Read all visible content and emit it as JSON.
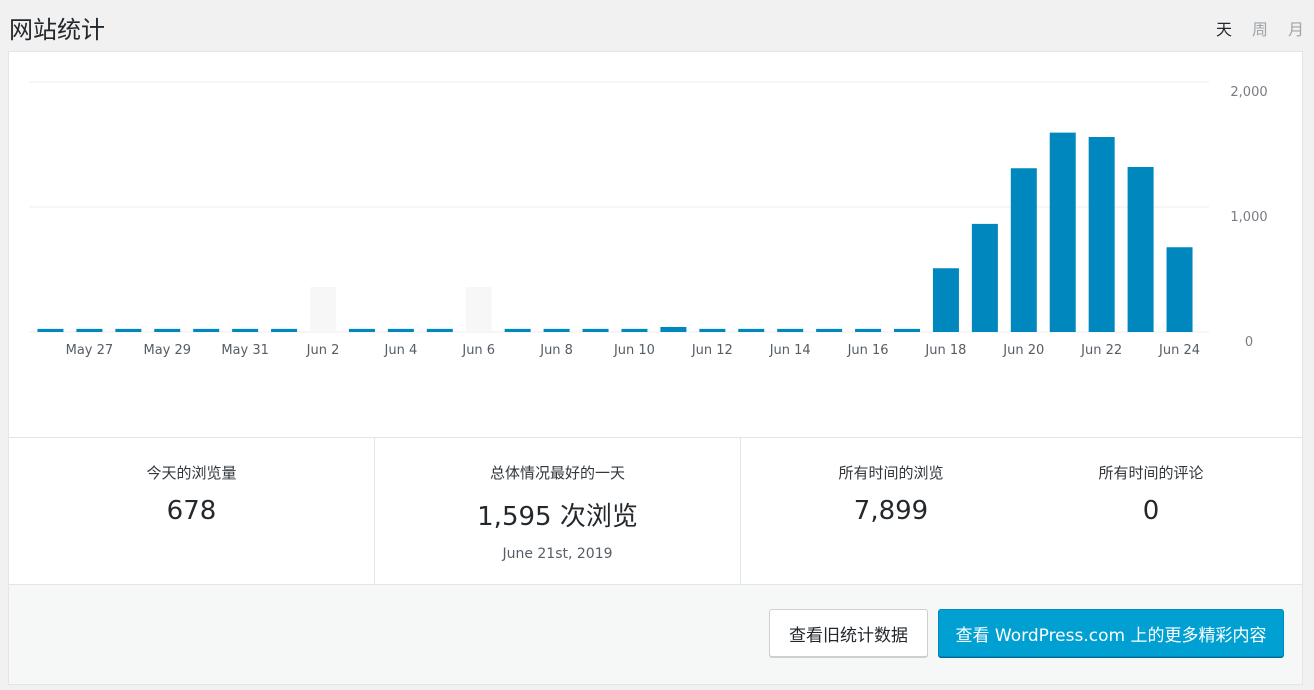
{
  "header": {
    "title": "网站统计",
    "periods": [
      {
        "label": "天",
        "active": true
      },
      {
        "label": "周",
        "active": false
      },
      {
        "label": "月",
        "active": false
      }
    ]
  },
  "chart_data": {
    "type": "bar",
    "categories": [
      "May 26",
      "May 27",
      "May 28",
      "May 29",
      "May 30",
      "May 31",
      "Jun 1",
      "Jun 2",
      "Jun 3",
      "Jun 4",
      "Jun 5",
      "Jun 6",
      "Jun 7",
      "Jun 8",
      "Jun 9",
      "Jun 10",
      "Jun 11",
      "Jun 12",
      "Jun 13",
      "Jun 14",
      "Jun 15",
      "Jun 16",
      "Jun 17",
      "Jun 18",
      "Jun 19",
      "Jun 20",
      "Jun 21",
      "Jun 22",
      "Jun 23",
      "Jun 24"
    ],
    "values": [
      25,
      25,
      25,
      25,
      25,
      25,
      25,
      0,
      25,
      25,
      25,
      0,
      25,
      25,
      25,
      25,
      40,
      25,
      25,
      25,
      25,
      25,
      25,
      510,
      865,
      1310,
      1595,
      1560,
      1320,
      678
    ],
    "x_tick_labels": [
      "May 27",
      "May 29",
      "May 31",
      "Jun 2",
      "Jun 4",
      "Jun 6",
      "Jun 8",
      "Jun 10",
      "Jun 12",
      "Jun 14",
      "Jun 16",
      "Jun 18",
      "Jun 20",
      "Jun 22",
      "Jun 24"
    ],
    "y_tick_labels": [
      "0",
      "1,000",
      "2,000"
    ],
    "ylim": [
      0,
      2000
    ],
    "grid": true,
    "bar_color": "#0087be",
    "title": "",
    "xlabel": "",
    "ylabel": ""
  },
  "stats": {
    "today_label": "今天的浏览量",
    "today_value": "678",
    "best_label": "总体情况最好的一天",
    "best_value": "1,595 次浏览",
    "best_date": "June 21st, 2019",
    "alltime_views_label": "所有时间的浏览",
    "alltime_views_value": "7,899",
    "alltime_comments_label": "所有时间的评论",
    "alltime_comments_value": "0"
  },
  "footer": {
    "old_stats_label": "查看旧统计数据",
    "more_label": "查看 WordPress.com 上的更多精彩内容"
  }
}
